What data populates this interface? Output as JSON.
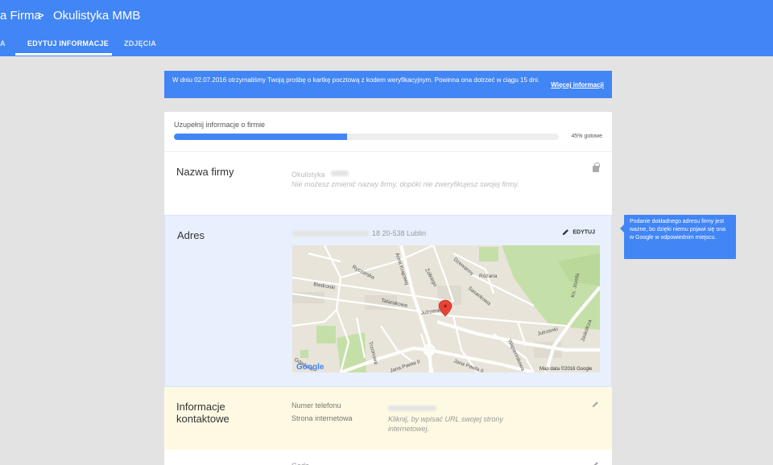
{
  "header": {
    "parent_label": "a Firma",
    "separator": ">",
    "title": "Okulistyka MMB",
    "tabs": [
      {
        "label": "A"
      },
      {
        "label": "EDYTUJ INFORMACJE",
        "active": true
      },
      {
        "label": "ZDJĘCIA"
      }
    ]
  },
  "banner": {
    "message": "W dniu 02.07.2016 otrzymaliśmy Twoją prośbę o kartkę pocztową z kodem weryfikacyjnym. Powinna ona dotrzeć w ciągu 15 dni.",
    "link": "Więcej informacji"
  },
  "progress": {
    "label": "Uzupełnij informacje o firmie",
    "value": 45,
    "status": "45% gotowe"
  },
  "business_name": {
    "title": "Nazwa firmy",
    "value": "Okulistyka",
    "note": "Nie możesz zmienić nazwy firmy, dopóki nie zweryfikujesz swojej firmy.",
    "icon": "lock-icon"
  },
  "address": {
    "title": "Adres",
    "value_visible": "18 20-538 Lublin",
    "edit_label": "EDYTUJ",
    "map": {
      "streets": [
        "Ryczarska",
        "Armii Krajowej",
        "Dzewanny",
        "Żółkiego",
        "Różana",
        "Biedronki",
        "Sasankowa",
        "Tatarakowa",
        "Jutrzenki",
        "Jutrzenki",
        "Trzcinowa",
        "Gdańska",
        "Jana Pawła II",
        "Jana Pawła II",
        "Wapiennikowa",
        "Ks. Józefa",
        "Jaskółcza"
      ],
      "copyright": "Map data ©2016 Google",
      "logo": "Google"
    },
    "tooltip": "Podanie dokładnego adresu firmy jest ważne, bo dzięki niemu pojawi się ona w Google w odpowiednim miejscu."
  },
  "contact": {
    "title": "Informacje kontaktowe",
    "phone_label": "Numer telefonu",
    "website_label": "Strona internetowa",
    "website_placeholder": "Kliknij, by wpisać URL swojej strony internetowej."
  },
  "next_section": {
    "key": "Godz"
  },
  "colors": {
    "brand_blue": "#4285f4",
    "address_bg": "#e8f0fe",
    "contact_bg": "#fef9e3"
  }
}
